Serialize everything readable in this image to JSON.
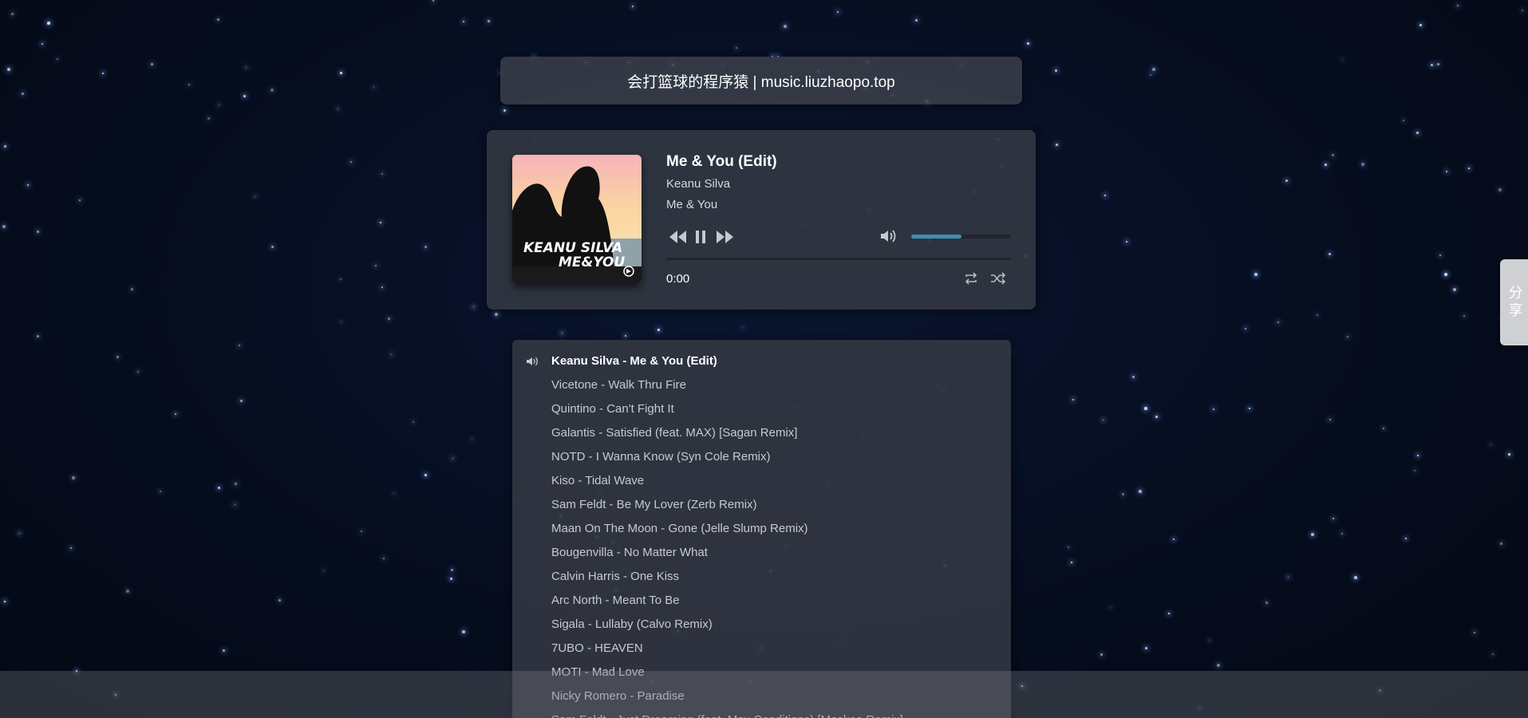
{
  "header": {
    "title": "会打篮球的程序猿 | music.liuzhaopo.top"
  },
  "player": {
    "cover_text_line1": "KEANU SILVA",
    "cover_text_line2": "ME&YOU",
    "title": "Me & You (Edit)",
    "artist": "Keanu Silva",
    "album": "Me & You",
    "time": "0:00",
    "volume": 0.5,
    "progress": 0,
    "icons": {
      "prev": "rewind-icon",
      "pause": "pause-icon",
      "next": "fast-forward-icon",
      "volume": "volume-icon",
      "repeat": "repeat-icon",
      "shuffle": "shuffle-icon"
    },
    "accent_color": "#3b8fb5"
  },
  "playlist": {
    "items": [
      "Keanu Silva - Me & You (Edit)",
      "Vicetone - Walk Thru Fire",
      "Quintino - Can't Fight It",
      "Galantis - Satisfied (feat. MAX) [Sagan Remix]",
      "NOTD - I Wanna Know (Syn Cole Remix)",
      "Kiso - Tidal Wave",
      "Sam Feldt - Be My Lover (Zerb Remix)",
      "Maan On The Moon - Gone (Jelle Slump Remix)",
      "Bougenvilla - No Matter What",
      "Calvin Harris - One Kiss",
      "Arc North - Meant To Be",
      "Sigala - Lullaby (Calvo Remix)",
      "7UBO - HEAVEN",
      "MOTI - Mad Love",
      "Nicky Romero - Paradise",
      "Sam Feldt - Just Dreaming (feat. Max Conditions) [Moskoe Remix]"
    ],
    "active_index": 0
  },
  "share": {
    "label": "分享"
  }
}
